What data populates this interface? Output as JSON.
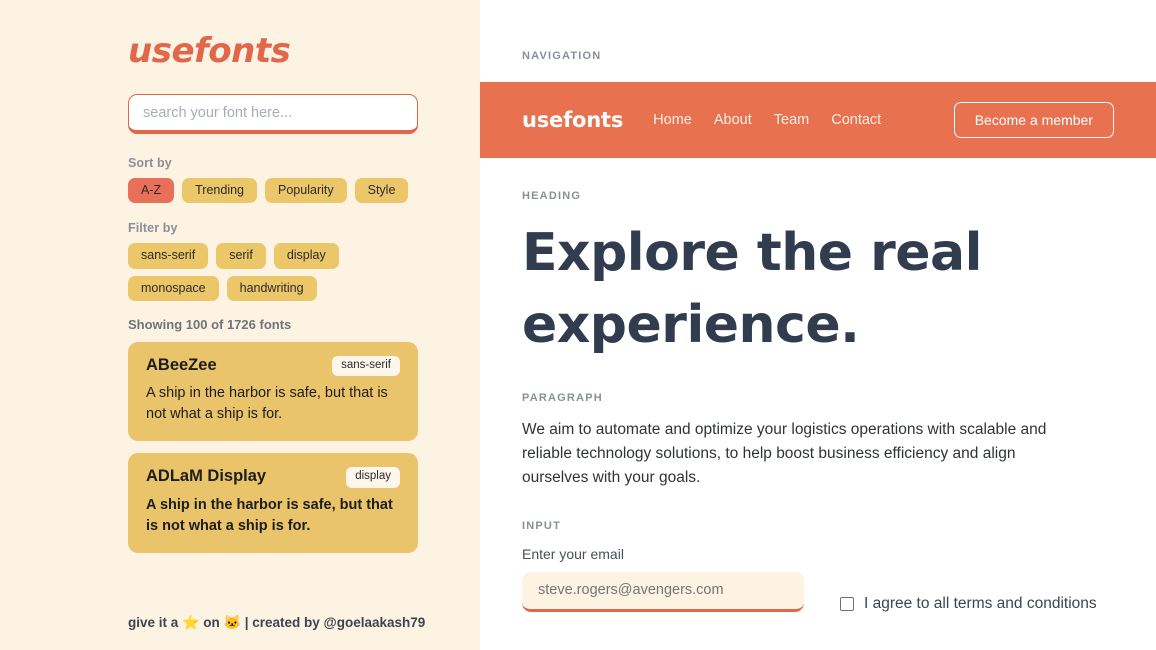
{
  "sidebar": {
    "brand": "usefonts",
    "search": {
      "placeholder": "search your font here...",
      "value": ""
    },
    "sort": {
      "label": "Sort by",
      "options": [
        {
          "label": "A-Z",
          "active": true
        },
        {
          "label": "Trending",
          "active": false
        },
        {
          "label": "Popularity",
          "active": false
        },
        {
          "label": "Style",
          "active": false
        }
      ]
    },
    "filter": {
      "label": "Filter by",
      "options": [
        {
          "label": "sans-serif"
        },
        {
          "label": "serif"
        },
        {
          "label": "display"
        },
        {
          "label": "monospace"
        },
        {
          "label": "handwriting"
        }
      ]
    },
    "showing": "Showing 100 of 1726 fonts",
    "fonts": [
      {
        "name": "ABeeZee",
        "tag": "sans-serif",
        "sample": "A ship in the harbor is safe, but that is not what a ship is for."
      },
      {
        "name": "ADLaM Display",
        "tag": "display",
        "sample": "A ship in the harbor is safe, but that is not what a ship is for."
      }
    ],
    "footer": {
      "text_before": "give it a",
      "star": "⭐",
      "text_mid": "on",
      "github": "🐱",
      "text_after": "| created by",
      "handle": "@goelaakash79"
    }
  },
  "main": {
    "nav_section_label": "NAVIGATION",
    "navbar": {
      "brand": "usefonts",
      "links": [
        "Home",
        "About",
        "Team",
        "Contact"
      ],
      "cta": "Become a member"
    },
    "heading_section_label": "HEADING",
    "heading": "Explore the real experience.",
    "paragraph_section_label": "PARAGRAPH",
    "paragraph": "We aim to automate and optimize your logistics operations with scalable and reliable technology solutions, to help boost business efficiency and align ourselves with your goals.",
    "input_section_label": "INPUT",
    "input": {
      "caption": "Enter your email",
      "value": "steve.rogers@avengers.com",
      "placeholder": "steve.rogers@avengers.com",
      "terms_label": "I agree to all terms and conditions",
      "terms_checked": false
    }
  },
  "colors": {
    "cream": "#fdf3e3",
    "coral": "#e8714f",
    "coral_dark": "#e2674a",
    "gold": "#e9c46a",
    "chip_gold": "#ecc76a",
    "chip_active": "#e8705a",
    "heading_navy": "#313d4f"
  }
}
